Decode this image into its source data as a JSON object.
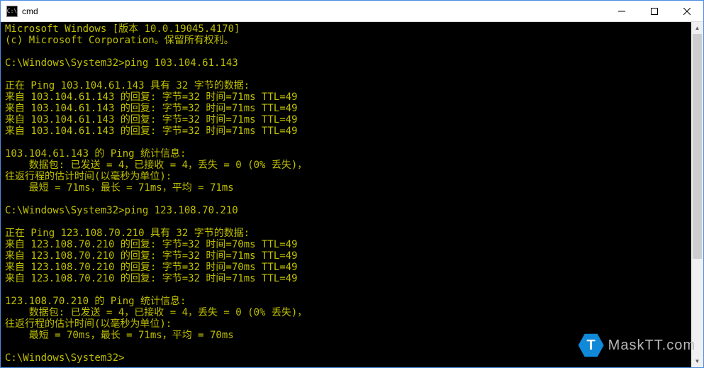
{
  "titlebar": {
    "title": "cmd",
    "icon_label": "C:\\"
  },
  "terminal": {
    "lines": [
      "Microsoft Windows [版本 10.0.19045.4170]",
      "(c) Microsoft Corporation。保留所有权利。",
      "",
      "C:\\Windows\\System32>ping 103.104.61.143",
      "",
      "正在 Ping 103.104.61.143 具有 32 字节的数据:",
      "来自 103.104.61.143 的回复: 字节=32 时间=71ms TTL=49",
      "来自 103.104.61.143 的回复: 字节=32 时间=71ms TTL=49",
      "来自 103.104.61.143 的回复: 字节=32 时间=71ms TTL=49",
      "来自 103.104.61.143 的回复: 字节=32 时间=71ms TTL=49",
      "",
      "103.104.61.143 的 Ping 统计信息:",
      "    数据包: 已发送 = 4，已接收 = 4，丢失 = 0 (0% 丢失)，",
      "往返行程的估计时间(以毫秒为单位):",
      "    最短 = 71ms，最长 = 71ms，平均 = 71ms",
      "",
      "C:\\Windows\\System32>ping 123.108.70.210",
      "",
      "正在 Ping 123.108.70.210 具有 32 字节的数据:",
      "来自 123.108.70.210 的回复: 字节=32 时间=70ms TTL=49",
      "来自 123.108.70.210 的回复: 字节=32 时间=71ms TTL=49",
      "来自 123.108.70.210 的回复: 字节=32 时间=70ms TTL=49",
      "来自 123.108.70.210 的回复: 字节=32 时间=71ms TTL=49",
      "",
      "123.108.70.210 的 Ping 统计信息:",
      "    数据包: 已发送 = 4，已接收 = 4，丢失 = 0 (0% 丢失)，",
      "往返行程的估计时间(以毫秒为单位):",
      "    最短 = 70ms，最长 = 71ms，平均 = 70ms",
      "",
      "C:\\Windows\\System32>"
    ]
  },
  "watermark": {
    "badge": "T",
    "text": "MaskTT.com"
  }
}
